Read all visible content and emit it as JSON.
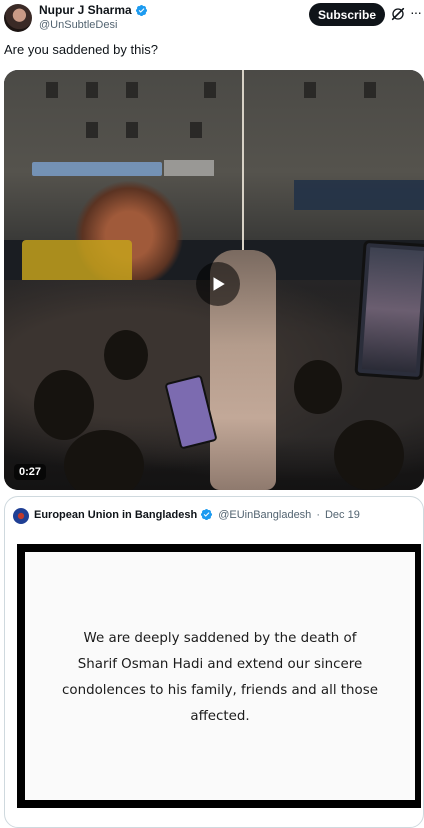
{
  "author": {
    "display_name": "Nupur J Sharma",
    "handle": "@UnSubtleDesi",
    "verified": true
  },
  "actions": {
    "subscribe_label": "Subscribe",
    "grok_icon": "grok-icon",
    "more_icon": "more-icon"
  },
  "tweet": {
    "text": "Are you saddened by this?"
  },
  "video": {
    "duration": "0:27",
    "play_icon": "play-icon"
  },
  "quoted_post": {
    "display_name": "European Union in Bangladesh",
    "handle": "@EUinBangladesh",
    "separator": "·",
    "date": "Dec 19",
    "verified": true,
    "image_text_lines": [
      "We are deeply saddened by the death of",
      "Sharif Osman Hadi and extend our sincere",
      "condolences to his family, friends and all those",
      "affected."
    ]
  },
  "colors": {
    "verified_blue": "#1d9bf0",
    "text_primary": "#0f1419",
    "text_secondary": "#536471",
    "border": "#cfd9de"
  }
}
